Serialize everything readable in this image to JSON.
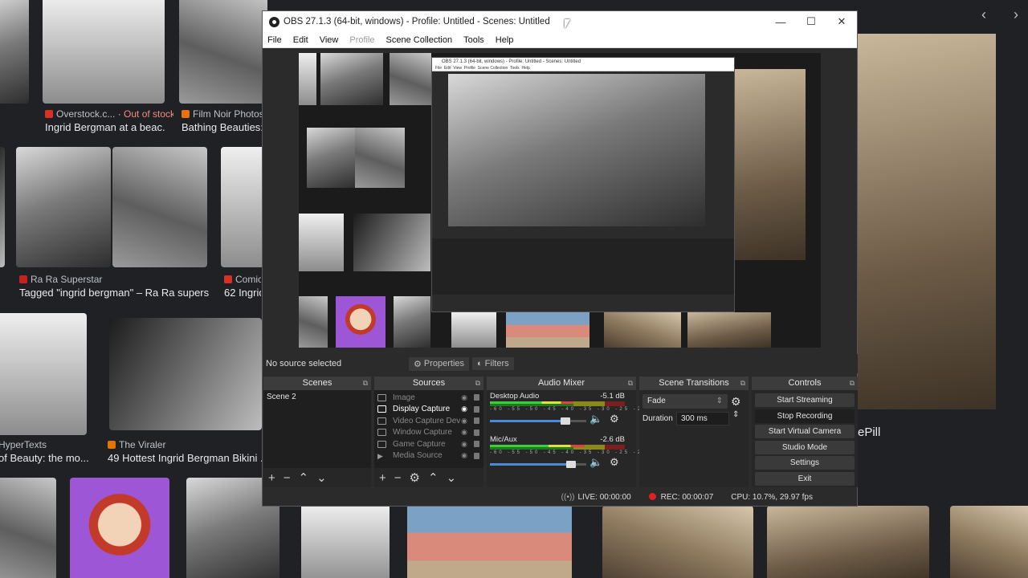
{
  "background": {
    "results": [
      {
        "source": "Overstock.c...",
        "stock": "Out of stock",
        "title": "Ingrid Bergman at a beac..."
      },
      {
        "source": "Film Noir Photos",
        "title": "Bathing Beauties:"
      },
      {
        "source": "Ra Ra Superstar",
        "title": "Tagged \"ingrid bergman\" – Ra Ra superst..."
      },
      {
        "source": "Comic",
        "title": "62 Ingrid"
      },
      {
        "source": "HyperTexts",
        "title": "of Beauty: the mo..."
      },
      {
        "source": "The Viraler",
        "title": "49 Hottest Ingrid Bergman Bikini ..."
      }
    ],
    "right_panel_name": "ePill",
    "nav_prev": "‹",
    "nav_next": "›"
  },
  "obs": {
    "title": "OBS 27.1.3 (64-bit, windows) - Profile: Untitled - Scenes: Untitled",
    "window_buttons": {
      "minimize": "—",
      "maximize": "☐",
      "close": "✕"
    },
    "menu": [
      "File",
      "Edit",
      "View",
      "Profile",
      "Scene Collection",
      "Tools",
      "Help"
    ],
    "no_source": "No source selected",
    "properties_label": "Properties",
    "filters_label": "Filters",
    "docks": {
      "scenes": "Scenes",
      "sources": "Sources",
      "mixer": "Audio Mixer",
      "transitions": "Scene Transitions",
      "controls": "Controls"
    },
    "scenes": [
      "Scene 2"
    ],
    "sources": [
      {
        "name": "Image",
        "active": false
      },
      {
        "name": "Display Capture",
        "active": true
      },
      {
        "name": "Video Capture Dev",
        "active": false
      },
      {
        "name": "Window Capture",
        "active": false
      },
      {
        "name": "Game Capture",
        "active": false
      },
      {
        "name": "Media Source",
        "active": false
      }
    ],
    "mixer": [
      {
        "name": "Desktop Audio",
        "db": "-5.1 dB",
        "level": 0.62,
        "volume": 0.78
      },
      {
        "name": "Mic/Aux",
        "db": "-2.6 dB",
        "level": 0.7,
        "volume": 0.84
      }
    ],
    "mixer_ticks": "-60 -55 -50 -45 -40 -35 -30 -25 -20 -15 -10 -5 0",
    "transition": "Fade",
    "duration_label": "Duration",
    "duration_value": "300 ms",
    "controls": [
      "Start Streaming",
      "Stop Recording",
      "Start Virtual Camera",
      "Studio Mode",
      "Settings",
      "Exit"
    ],
    "status": {
      "live": "LIVE: 00:00:00",
      "rec": "REC: 00:00:07",
      "cpu": "CPU: 10.7%, 29.97 fps"
    },
    "nested_title": "OBS 27.1.3 (64-bit, windows) - Profile: Untitled - Scenes: Untitled",
    "nested_menu": [
      "File",
      "Edit",
      "View",
      "Profile",
      "Scene Collection",
      "Tools",
      "Help"
    ]
  },
  "colors": {
    "accent": "#4a8ad8",
    "rec": "#dd2222",
    "bg": "#202124"
  }
}
